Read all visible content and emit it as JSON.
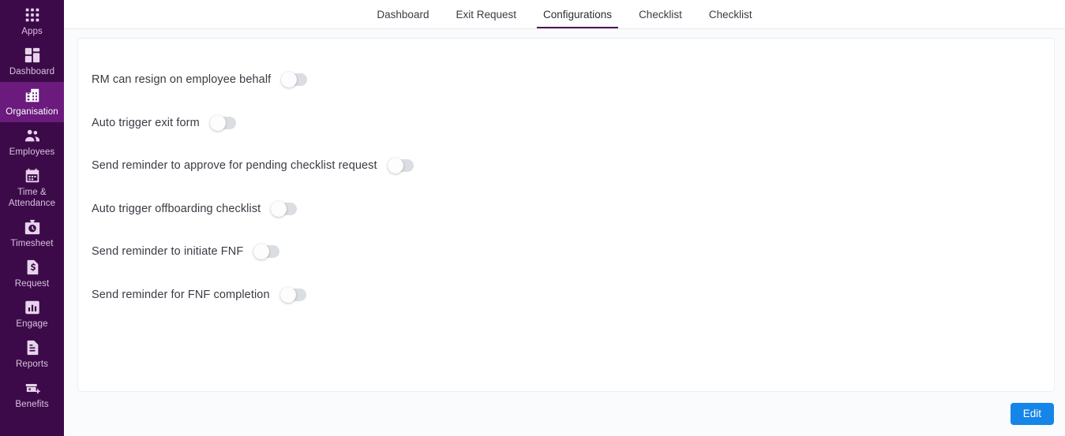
{
  "sidebar": {
    "background_color": "#3c0a49",
    "active_background_color": "#6b1a7d",
    "items": [
      {
        "label": "Apps",
        "icon": "apps-grid-icon",
        "active": false
      },
      {
        "label": "Dashboard",
        "icon": "dashboard-icon",
        "active": false
      },
      {
        "label": "Organisation",
        "icon": "building-icon",
        "active": true
      },
      {
        "label": "Employees",
        "icon": "people-icon",
        "active": false
      },
      {
        "label": "Time &\nAttendance",
        "icon": "calendar-icon",
        "active": false
      },
      {
        "label": "Timesheet",
        "icon": "clock-bag-icon",
        "active": false
      },
      {
        "label": "Request",
        "icon": "money-doc-icon",
        "active": false
      },
      {
        "label": "Engage",
        "icon": "bar-chart-icon",
        "active": false
      },
      {
        "label": "Reports",
        "icon": "document-icon",
        "active": false
      },
      {
        "label": "Benefits",
        "icon": "benefits-add-icon",
        "active": false
      }
    ]
  },
  "topbar": {
    "active_underline_color": "#4e1357",
    "tabs": [
      {
        "label": "Dashboard",
        "active": false
      },
      {
        "label": "Exit Request",
        "active": false
      },
      {
        "label": "Configurations",
        "active": true
      },
      {
        "label": "Checklist",
        "active": false
      },
      {
        "label": "Checklist",
        "active": false
      }
    ]
  },
  "settings": {
    "rows": [
      {
        "label": "RM can resign on employee behalf",
        "enabled": false
      },
      {
        "label": "Auto trigger exit form",
        "enabled": false
      },
      {
        "label": "Send reminder to approve for pending checklist request",
        "enabled": false
      },
      {
        "label": "Auto trigger offboarding checklist",
        "enabled": false
      },
      {
        "label": "Send reminder to initiate FNF",
        "enabled": false
      },
      {
        "label": "Send reminder for FNF completion",
        "enabled": false
      }
    ]
  },
  "footer": {
    "edit_label": "Edit",
    "edit_color": "#1585e8"
  }
}
